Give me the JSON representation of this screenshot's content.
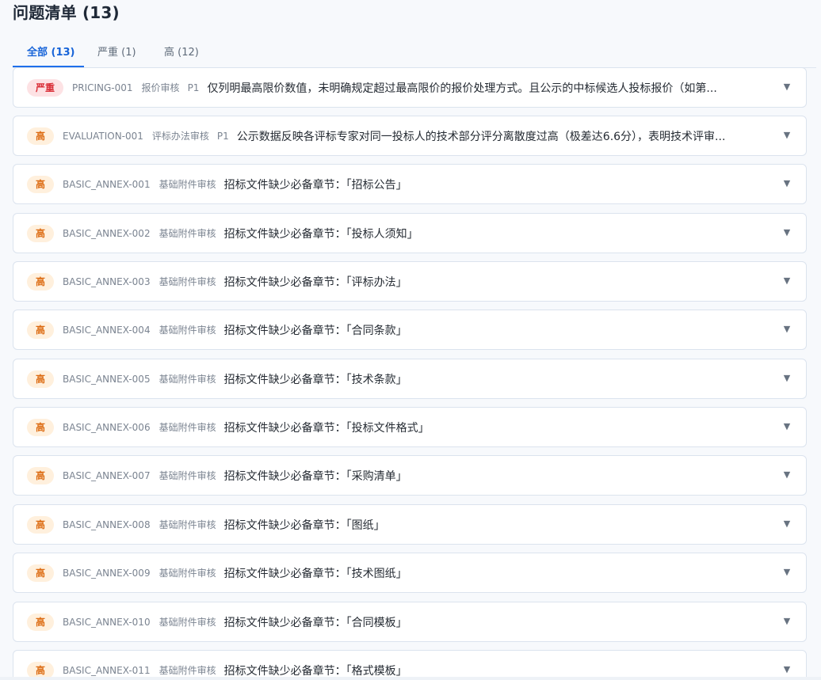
{
  "header": {
    "title": "问题清单 (13)"
  },
  "tabs": [
    {
      "label": "全部 (13)",
      "active": true
    },
    {
      "label": "严重 (1)",
      "active": false
    },
    {
      "label": "高 (12)",
      "active": false
    }
  ],
  "issues": [
    {
      "severity": "严重",
      "code": "PRICING-001",
      "category": "报价审核",
      "priority": "P1",
      "description": "仅列明最高限价数值，未明确规定超过最高限价的报价处理方式。且公示的中标候选人投标报价（如第..."
    },
    {
      "severity": "高",
      "code": "EVALUATION-001",
      "category": "评标办法审核",
      "priority": "P1",
      "description": "公示数据反映各评标专家对同一投标人的技术部分评分离散度过高（极差达6.6分），表明技术评审..."
    },
    {
      "severity": "高",
      "code": "BASIC_ANNEX-001",
      "category": "基础附件审核",
      "description": "招标文件缺少必备章节：「招标公告」"
    },
    {
      "severity": "高",
      "code": "BASIC_ANNEX-002",
      "category": "基础附件审核",
      "description": "招标文件缺少必备章节：「投标人须知」"
    },
    {
      "severity": "高",
      "code": "BASIC_ANNEX-003",
      "category": "基础附件审核",
      "description": "招标文件缺少必备章节：「评标办法」"
    },
    {
      "severity": "高",
      "code": "BASIC_ANNEX-004",
      "category": "基础附件审核",
      "description": "招标文件缺少必备章节：「合同条款」"
    },
    {
      "severity": "高",
      "code": "BASIC_ANNEX-005",
      "category": "基础附件审核",
      "description": "招标文件缺少必备章节：「技术条款」"
    },
    {
      "severity": "高",
      "code": "BASIC_ANNEX-006",
      "category": "基础附件审核",
      "description": "招标文件缺少必备章节：「投标文件格式」"
    },
    {
      "severity": "高",
      "code": "BASIC_ANNEX-007",
      "category": "基础附件审核",
      "description": "招标文件缺少必备章节：「采购清单」"
    },
    {
      "severity": "高",
      "code": "BASIC_ANNEX-008",
      "category": "基础附件审核",
      "description": "招标文件缺少必备章节：「图纸」"
    },
    {
      "severity": "高",
      "code": "BASIC_ANNEX-009",
      "category": "基础附件审核",
      "description": "招标文件缺少必备章节：「技术图纸」"
    },
    {
      "severity": "高",
      "code": "BASIC_ANNEX-010",
      "category": "基础附件审核",
      "description": "招标文件缺少必备章节：「合同模板」"
    },
    {
      "severity": "高",
      "code": "BASIC_ANNEX-011",
      "category": "基础附件审核",
      "description": "招标文件缺少必备章节：「格式模板」"
    }
  ],
  "icons": {
    "expand": "chevron-down-icon"
  },
  "colors": {
    "accent": "#1f6feb",
    "critical_background": "#fde2e4",
    "critical_text": "#d92d36",
    "high_background": "#fff0dd",
    "high_text": "#dc6a10"
  }
}
